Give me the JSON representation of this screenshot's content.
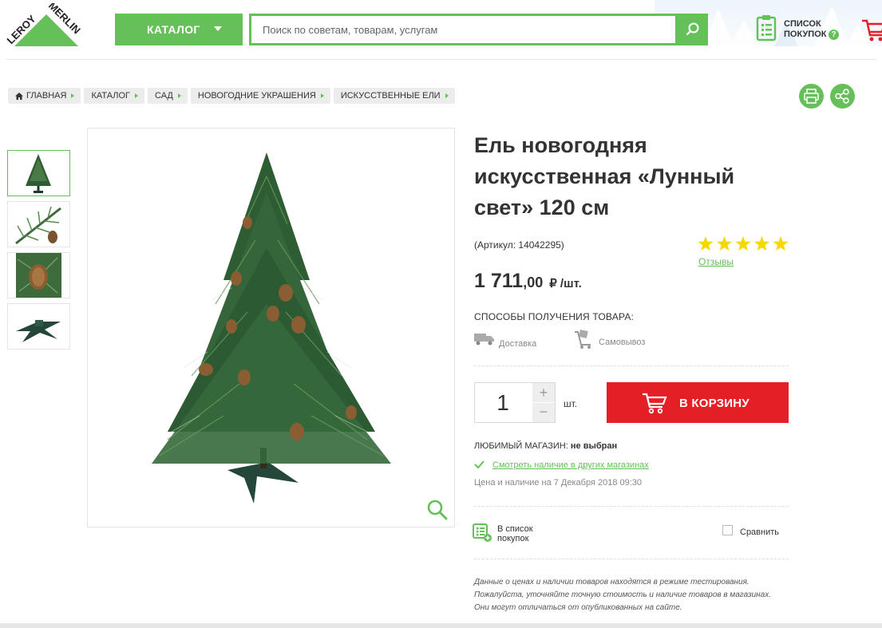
{
  "header": {
    "logo_text": "LEROY MERLIN",
    "catalog_label": "КАТАЛОГ",
    "search_placeholder": "Поиск по советам, товарам, услугам",
    "shopping_list_line1": "СПИСОК",
    "shopping_list_line2": "ПОКУПОК",
    "help_symbol": "?"
  },
  "breadcrumbs": [
    "ГЛАВНАЯ",
    "КАТАЛОГ",
    "САД",
    "НОВОГОДНИЕ УКРАШЕНИЯ",
    "ИСКУССТВЕННЫЕ ЕЛИ"
  ],
  "product": {
    "title": "Ель новогодняя искусственная «Лунный свет» 120 см",
    "article": "(Артикул: 14042295)",
    "rating": 5,
    "rating_max": 5,
    "reviews_label": "Отзывы",
    "price_int": "1 711",
    "price_dec": ",00",
    "price_unit": "₽ /шт."
  },
  "delivery": {
    "heading": "СПОСОБЫ ПОЛУЧЕНИЯ ТОВАРА:",
    "delivery_label": "Доставка",
    "pickup_label": "Самовывоз"
  },
  "purchase": {
    "quantity": "1",
    "plus": "+",
    "minus": "−",
    "unit": "шт.",
    "add_to_cart_label": "В КОРЗИНУ"
  },
  "store": {
    "favorite_label": "ЛЮБИМЫЙ МАГАЗИН: ",
    "favorite_value": "не выбран",
    "other_stores_link": "Смотреть наличие в других магазинах",
    "price_date": "Цена и наличие на 7 Декабря 2018 09:30"
  },
  "actions": {
    "add_to_list_line1": "В список",
    "add_to_list_line2": "покупок",
    "compare_label": "Сравнить"
  },
  "disclaimer": "Данные о ценах и наличии товаров находятся в режиме тестирования. Пожалуйста, уточняйте точную стоимость и наличие товаров в магазинах. Они могут отличаться от опубликованных на сайте.",
  "colors": {
    "brand_green": "#66c05a",
    "cart_red": "#e51f26",
    "star_yellow": "#f5d800"
  },
  "icons": [
    "search-icon",
    "shopping-list-icon",
    "cart-icon",
    "home-icon",
    "print-icon",
    "share-icon",
    "zoom-icon",
    "truck-icon",
    "pickup-cart-icon",
    "check-icon",
    "list-add-icon"
  ]
}
